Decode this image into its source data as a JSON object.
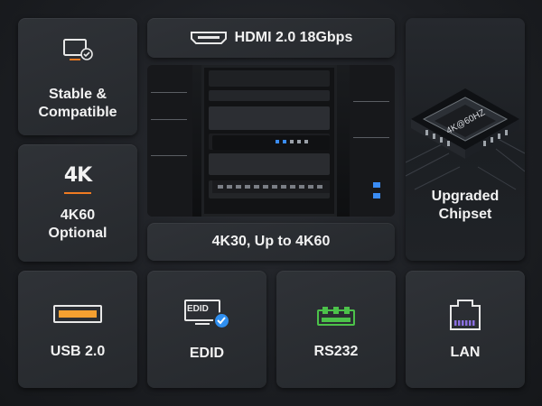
{
  "tiles": {
    "stable": "Stable &\nCompatible",
    "k4_icon": "4K",
    "k4_label": "4K60\nOptional",
    "hdmi": "HDMI 2.0 18Gbps",
    "resolution": "4K30, Up to 4K60",
    "chipset": "Upgraded\nChipset",
    "chip_text": "4K@60HZ",
    "usb": "USB 2.0",
    "edid_icon": "EDID",
    "edid": "EDID",
    "rs232": "RS232",
    "lan": "LAN"
  },
  "icons": {
    "stable": "monitor-check-icon",
    "hdmi": "hdmi-port-icon",
    "usb": "usb-port-icon",
    "edid": "edid-check-icon",
    "rs232": "rs232-connector-icon",
    "lan": "ethernet-port-icon"
  },
  "colors": {
    "accent_orange": "#f07b22",
    "usb_orange": "#f5a030",
    "rs232_green": "#4cc24a",
    "lan_purple": "#8b6fe0",
    "check_blue": "#2f8ff0"
  }
}
